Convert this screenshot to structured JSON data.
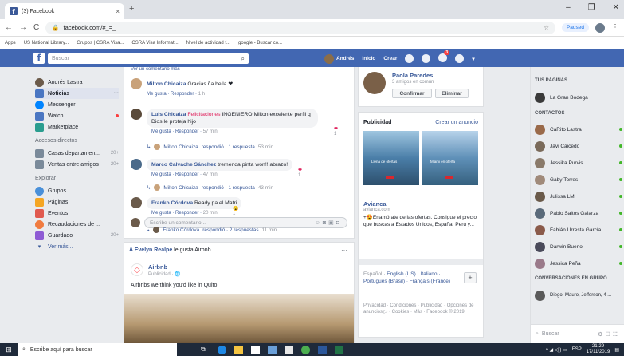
{
  "browser": {
    "tab_title": "(3) Facebook",
    "tab_close": "×",
    "new_tab": "+",
    "url": "facebook.com/#_=_",
    "paused_label": "Paused",
    "win_min": "–",
    "win_max": "❐",
    "win_close": "✕"
  },
  "bookmarks": [
    "Apps",
    "US National Library...",
    "Grupos | CSRA Visa...",
    "CSRA Visa Informat...",
    "Nivel de actividad f...",
    "google - Buscar co..."
  ],
  "fb": {
    "search_placeholder": "Buscar",
    "user_name": "Andrés",
    "nav_home": "Inicio",
    "nav_create": "Crear",
    "notif_count": "3",
    "brand_color": "#4267b2"
  },
  "left_nav": {
    "profile": "Andrés Lastra",
    "news": "Noticias",
    "messenger": "Messenger",
    "watch": "Watch",
    "marketplace": "Marketplace",
    "shortcuts_title": "Accesos directos",
    "shortcut1": "Casas departamen...",
    "shortcut1_count": "20+",
    "shortcut2": "Ventas entre amigos",
    "shortcut2_count": "20+",
    "explore_title": "Explorar",
    "groups": "Grupos",
    "pages": "Páginas",
    "events": "Eventos",
    "fundraisers": "Recaudaciones de ...",
    "saved": "Guardado",
    "saved_count": "20+",
    "more": "Ver más..."
  },
  "feed": {
    "see_more": "Ver un comentario más",
    "c1_name": "Milton Chicaiza",
    "c1_text": "Gracias ña bella ❤",
    "c1_time": "1 h",
    "c2_name": "Luis Chicaiza",
    "c2_tag": "Felicitaciones",
    "c2_text": "INGENIERO Milton excelente perfil q Dios le proteja hijo",
    "c2_time": "57 min",
    "c2_reacts": "1",
    "r1_name": "Milton Chicaiza",
    "r1_text": "respondió · 1 respuesta",
    "r1_time": "53 min",
    "c3_name": "Marco Calvache Sánchez",
    "c3_text": "tremenda pinta won!! abrazo!",
    "c3_time": "47 min",
    "c3_reacts": "1",
    "r2_name": "Milton Chicaiza",
    "r2_text": "respondió · 1 respuesta",
    "r2_time": "43 min",
    "c4_name": "Franko Córdova",
    "c4_text": "Ready pa el Matri",
    "c4_time": "20 min",
    "c4_reacts": "1",
    "r3_name": "Franko Córdova",
    "r3_text": "respondió · 2 respuestas",
    "r3_time": "11 min",
    "like": "Me gusta",
    "respond": "Responder",
    "write_placeholder": "Escribe un comentario...",
    "like_header_name": "A Evelyn Realpe",
    "like_header_rest": "le gusta Airbnb.",
    "post_name": "Airbnb",
    "post_sub": "Publicidad · 🌐",
    "post_text": "Airbnbs we think you'd like in Quito."
  },
  "right": {
    "friend_name": "Paola Paredes",
    "mutual": "3 amigos en común",
    "confirm": "Confirmar",
    "delete": "Eliminar",
    "ads_title": "Publicidad",
    "create_ad": "Crear un anuncio",
    "ad_overlay1": "Llena de ofertas",
    "ad_overlay2": "Miami en oferta",
    "ad_name": "Avianca",
    "ad_url": "avianca.com",
    "ad_desc": "+😍Enamórate de las ofertas. Consigue el precio que buscas a Estados Unidos, España, Perú y...",
    "lang_text": "Español ·",
    "lang_links": "English (US) · Italiano · Português (Brasil) · Français (France)",
    "privacy": "Privacidad · Condiciones · Publicidad · Opciones de anuncios ▷ · Cookies · Más · Facebook © 2019"
  },
  "chat": {
    "pages_title": "TUS PÁGINAS",
    "page1": "La Gran Bodega",
    "contacts_title": "CONTACTOS",
    "contacts": [
      "CaRito Lastra",
      "Javi Caicedo",
      "Jessika Purvis",
      "Gaby Torres",
      "Julissa LM",
      "Pablo Saltos Galarza",
      "Fabián Urresta García",
      "Darwin Bueno",
      "Jessica Peña"
    ],
    "groups_title": "CONVERSACIONES EN GRUPO",
    "group1": "Diego, Mauro, Jefferson, 4 ...",
    "search": "Buscar"
  },
  "taskbar": {
    "search": "Escribe aquí para buscar",
    "lang": "ESP",
    "time": "21:29",
    "date": "17/11/2019"
  }
}
